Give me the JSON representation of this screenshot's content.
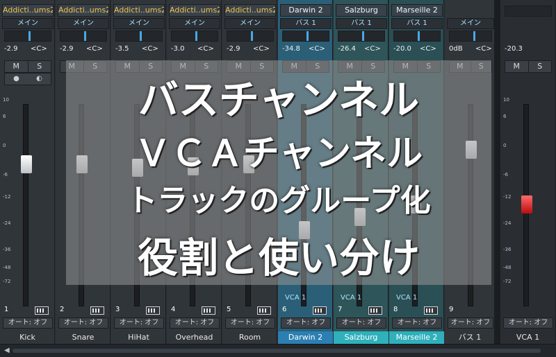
{
  "strips": [
    {
      "name_top": "Addicti..ums2",
      "route": "メイン",
      "volume": "-2.9",
      "pan": "<C>",
      "num": "1",
      "auto": "オート: オフ",
      "name": "Kick",
      "fader_level": 0.72,
      "variant": "track"
    },
    {
      "name_top": "Addicti..ums2",
      "route": "メイン",
      "volume": "-2.9",
      "pan": "<C>",
      "num": "2",
      "auto": "オート: オフ",
      "name": "Snare",
      "fader_level": 0.72,
      "variant": "track"
    },
    {
      "name_top": "Addicti..ums2",
      "route": "メイン",
      "volume": "-3.5",
      "pan": "<C>",
      "num": "3",
      "auto": "オート: オフ",
      "name": "HiHat",
      "fader_level": 0.7,
      "variant": "track"
    },
    {
      "name_top": "Addicti..ums2",
      "route": "メイン",
      "volume": "-3.0",
      "pan": "<C>",
      "num": "4",
      "auto": "オート: オフ",
      "name": "Overhead",
      "fader_level": 0.71,
      "variant": "track"
    },
    {
      "name_top": "Addicti..ums2",
      "route": "メイン",
      "volume": "-2.9",
      "pan": "<C>",
      "num": "5",
      "auto": "オート: オフ",
      "name": "Room",
      "fader_level": 0.72,
      "variant": "track"
    },
    {
      "name_top": "Darwin 2",
      "route": "バス 1",
      "volume": "-34.8",
      "pan": "<C>",
      "num": "6",
      "auto": "オート: オフ",
      "name": "Darwin 2",
      "vca": "VCA 1",
      "fader_level": 0.36,
      "variant": "selected"
    },
    {
      "name_top": "Salzburg",
      "route": "バス 1",
      "volume": "-26.4",
      "pan": "<C>",
      "num": "7",
      "auto": "オート: オフ",
      "name": "Salzburg",
      "vca": "VCA 1",
      "fader_level": 0.43,
      "variant": "bus"
    },
    {
      "name_top": "Marseille 2",
      "route": "バス 1",
      "volume": "-20.0",
      "pan": "<C>",
      "num": "8",
      "auto": "オート: オフ",
      "name": "Marseille 2",
      "vca": "VCA 1",
      "fader_level": 0.5,
      "variant": "bus2"
    },
    {
      "name_top": "",
      "route": "メイン",
      "volume": "0dB",
      "pan": "<C>",
      "num": "9",
      "auto": "オート: オフ",
      "name": "バス 1",
      "fader_level": 0.8,
      "variant": "track"
    }
  ],
  "vca_strip": {
    "volume": "-20.3",
    "num": "",
    "auto": "オート: オフ",
    "name": "VCA 1",
    "fader_level": 0.5
  },
  "controls": {
    "mute": "M",
    "solo": "S"
  },
  "scale": [
    "10",
    "6",
    "0",
    "-6",
    "-12",
    "-24",
    "-36",
    "-48",
    "-72"
  ],
  "overlay": {
    "line1": "バスチャンネル",
    "line2": "ＶＣＡチャンネル",
    "line3": "トラックのグループ化",
    "line4": "役割と使い分け"
  },
  "colors": {
    "accent_blue": "#2b7fb2",
    "bus_cyan": "#2fb1bb",
    "fader_red": "#d33"
  }
}
